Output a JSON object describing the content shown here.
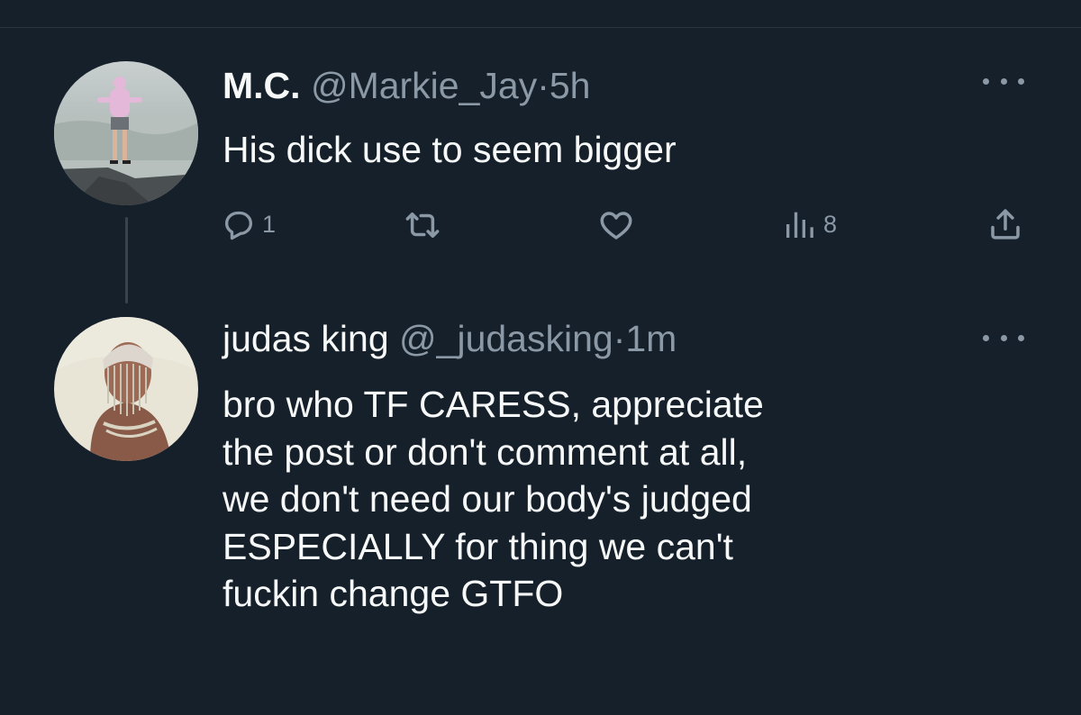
{
  "tweets": [
    {
      "display_name": "M.C.",
      "handle": "@Markie_Jay",
      "separator": "·",
      "time": "5h",
      "text": "His dick use to seem bigger",
      "actions": {
        "reply_count": "1",
        "views_count": "8"
      }
    },
    {
      "display_name": "judas king",
      "handle": "@_judasking",
      "separator": "·",
      "time": "1m",
      "text": "bro who TF CARESS, appreciate\nthe post or don't comment at all,\nwe don't need our body's judged\nESPECIALLY for thing we can't\nfuckin change GTFO"
    }
  ],
  "icons": {
    "reply": "reply-icon",
    "retweet": "retweet-icon",
    "like": "heart-icon",
    "views": "views-icon",
    "share": "share-icon",
    "more": "more-icon"
  },
  "colors": {
    "background": "#15202b",
    "text": "#f7f9f9",
    "secondary": "#8b98a5",
    "thread_line": "#38444d"
  }
}
